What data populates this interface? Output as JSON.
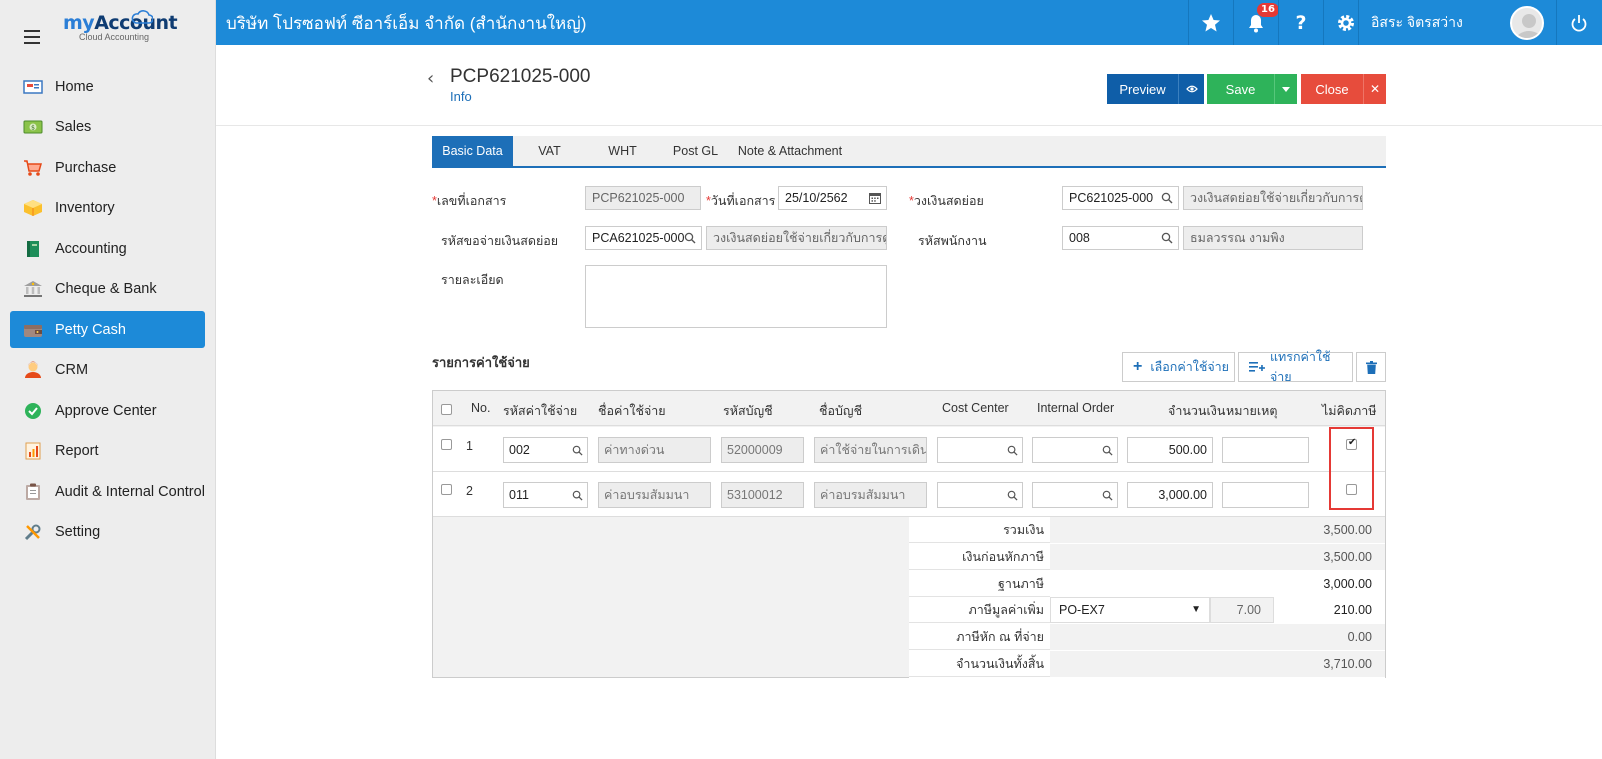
{
  "app": {
    "logo_main": "my",
    "logo_accent": "Account",
    "logo_sub": "Cloud Accounting",
    "company": "บริษัท โปรซอฟท์ ซีอาร์เอ็ม จำกัด (สำนักงานใหญ่)",
    "notifications": "16",
    "user": "อิสระ จิตรสว่าง"
  },
  "sidebar": {
    "items": [
      {
        "label": "Home",
        "icon": "home-icon"
      },
      {
        "label": "Sales",
        "icon": "money-icon"
      },
      {
        "label": "Purchase",
        "icon": "cart-icon"
      },
      {
        "label": "Inventory",
        "icon": "box-icon"
      },
      {
        "label": "Accounting",
        "icon": "book-icon"
      },
      {
        "label": "Cheque & Bank",
        "icon": "bank-icon"
      },
      {
        "label": "Petty Cash",
        "icon": "wallet-icon",
        "active": true
      },
      {
        "label": "CRM",
        "icon": "people-icon"
      },
      {
        "label": "Approve Center",
        "icon": "check-circle-icon"
      },
      {
        "label": "Report",
        "icon": "report-icon"
      },
      {
        "label": "Audit & Internal Control",
        "icon": "clipboard-icon"
      },
      {
        "label": "Setting",
        "icon": "tools-icon"
      }
    ]
  },
  "header": {
    "title": "PCP621025-000",
    "subtitle": "Info",
    "preview": "Preview",
    "save": "Save",
    "close": "Close"
  },
  "tabs": [
    "Basic Data",
    "VAT",
    "WHT",
    "Post GL",
    "Note & Attachment"
  ],
  "form": {
    "doc_no_label": "เลขที่เอกสาร",
    "doc_no": "PCP621025-000",
    "doc_date_label": "วันที่เอกสาร",
    "doc_date": "25/10/2562",
    "petty_fund_label": "วงเงินสดย่อย",
    "petty_fund_code": "PC621025-000",
    "petty_fund_name": "วงเงินสดย่อยใช้จ่ายเกี่ยวกับการดูแล",
    "request_label": "รหัสขอจ่ายเงินสดย่อย",
    "request_code": "PCA621025-000",
    "request_name": "วงเงินสดย่อยใช้จ่ายเกี่ยวกับการดูแล",
    "employee_label": "รหัสพนักงาน",
    "employee_code": "008",
    "employee_name": "ธมลวรรณ งามพิง",
    "detail_label": "รายละเอียด",
    "detail": ""
  },
  "expenses": {
    "title": "รายการค่าใช้จ่าย",
    "select_btn": "เลือกค่าใช้จ่าย",
    "insert_btn": "แทรกค่าใช้จ่าย",
    "columns": [
      "No.",
      "รหัสค่าใช้จ่าย",
      "ชื่อค่าใช้จ่าย",
      "รหัสบัญชี",
      "ชื่อบัญชี",
      "Cost Center",
      "Internal Order",
      "จำนวนเงิน",
      "หมายเหตุ",
      "ไม่คิดภาษี"
    ],
    "rows": [
      {
        "no": "1",
        "code": "002",
        "name": "ค่าทางด่วน",
        "acct": "52000009",
        "acct_name": "ค่าใช้จ่ายในการเดินท",
        "cost_center": "",
        "internal_order": "",
        "amount": "500.00",
        "remark": "",
        "no_tax": true
      },
      {
        "no": "2",
        "code": "011",
        "name": "ค่าอบรมสัมมนา",
        "acct": "53100012",
        "acct_name": "ค่าอบรมสัมมนา",
        "cost_center": "",
        "internal_order": "",
        "amount": "3,000.00",
        "remark": "",
        "no_tax": false
      }
    ]
  },
  "summary": {
    "total_label": "รวมเงิน",
    "total": "3,500.00",
    "pre_tax_label": "เงินก่อนหักภาษี",
    "pre_tax": "3,500.00",
    "tax_base_label": "ฐานภาษี",
    "tax_base": "3,000.00",
    "vat_label": "ภาษีมูลค่าเพิ่ม",
    "vat_code": "PO-EX7",
    "vat_rate": "7.00",
    "vat_amount": "210.00",
    "wht_label": "ภาษีหัก ณ ที่จ่าย",
    "wht": "0.00",
    "grand_label": "จำนวนเงินทั้งสิ้น",
    "grand": "3,710.00"
  },
  "colors": {
    "primary": "#1d8ad8",
    "save": "#2eb35a",
    "close": "#e74c3c",
    "preview": "#0f5ea8"
  }
}
